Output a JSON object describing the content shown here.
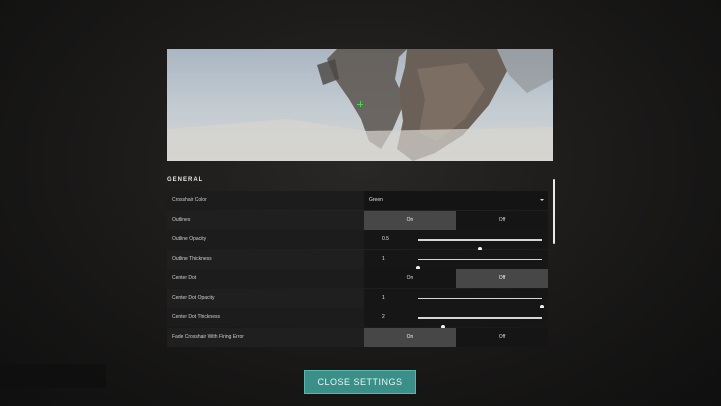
{
  "section": {
    "title": "GENERAL"
  },
  "rows": [
    {
      "label": "Crosshair Color",
      "type": "dropdown",
      "value": "Green"
    },
    {
      "label": "Outlines",
      "type": "toggle",
      "options": [
        "On",
        "Off"
      ],
      "selected": 0
    },
    {
      "label": "Outline Opacity",
      "type": "slider",
      "value": "0.5",
      "fraction": 0.5
    },
    {
      "label": "Outline Thickness",
      "type": "slider",
      "value": "1",
      "fraction": 0.0
    },
    {
      "label": "Center Dot",
      "type": "toggle",
      "options": [
        "On",
        "Off"
      ],
      "selected": 1
    },
    {
      "label": "Center Dot Opacity",
      "type": "slider",
      "value": "1",
      "fraction": 1.0
    },
    {
      "label": "Center Dot Thickness",
      "type": "slider",
      "value": "2",
      "fraction": 0.2
    },
    {
      "label": "Fade Crosshair With Firing Error",
      "type": "toggle",
      "options": [
        "On",
        "Off"
      ],
      "selected": 0
    }
  ],
  "footer": {
    "close_label": "CLOSE SETTINGS"
  },
  "colors": {
    "accent": "#3a8f88",
    "crosshair": "#3ddc4a"
  }
}
